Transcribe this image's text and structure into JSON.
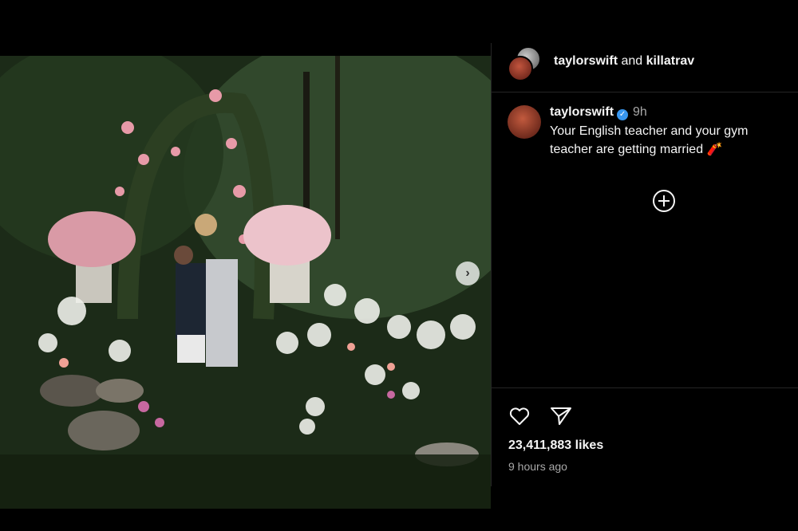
{
  "header": {
    "user1": "taylorswift",
    "conjunction": "and",
    "user2": "killatrav"
  },
  "caption": {
    "username": "taylorswift",
    "verified_icon": "✓",
    "time": "9h",
    "text": "Your English teacher and your gym teacher are getting married 🧨"
  },
  "stats": {
    "likes": "23,411,883 likes",
    "posted": "9 hours ago"
  },
  "icons": {
    "next": "chevron-right-icon",
    "add": "add-comment-icon",
    "like": "heart-icon",
    "share": "send-icon"
  },
  "colors": {
    "background": "#000000",
    "verified": "#3897f0",
    "muted": "#a8a8a8"
  }
}
